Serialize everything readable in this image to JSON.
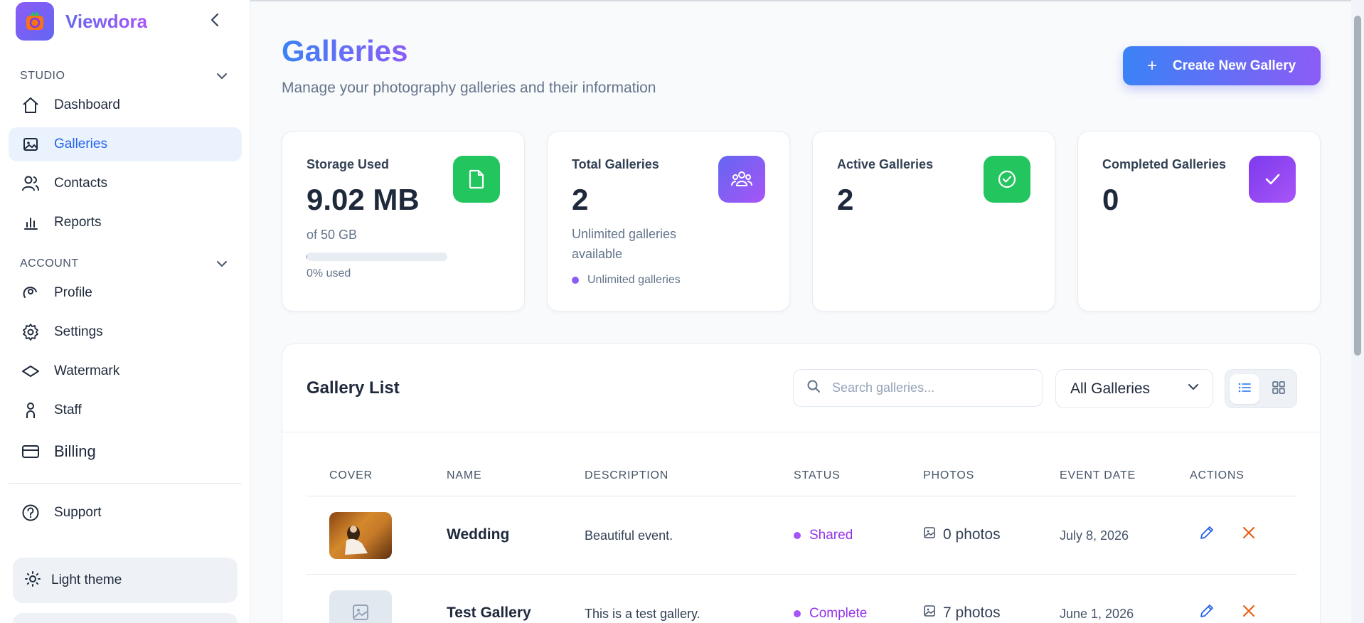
{
  "brand": {
    "name": "Viewdora"
  },
  "sidebar": {
    "sections": [
      {
        "label": "STUDIO"
      },
      {
        "label": "ACCOUNT"
      }
    ],
    "items": [
      {
        "label": "Dashboard",
        "icon": "home-icon"
      },
      {
        "label": "Galleries",
        "icon": "image-icon",
        "active": true
      },
      {
        "label": "Contacts",
        "icon": "users-icon"
      },
      {
        "label": "Reports",
        "icon": "bar-chart-icon"
      },
      {
        "label": "Profile",
        "icon": "profile-icon"
      },
      {
        "label": "Settings",
        "icon": "gear-icon"
      },
      {
        "label": "Watermark",
        "icon": "watermark-icon"
      },
      {
        "label": "Staff",
        "icon": "staff-icon"
      },
      {
        "label": "Billing",
        "icon": "credit-card-icon"
      },
      {
        "label": "Support",
        "icon": "help-circle-icon"
      }
    ],
    "theme_label": "Light theme"
  },
  "header": {
    "title": "Galleries",
    "subtitle": "Manage your photography galleries and their information",
    "create_label": "Create New Gallery"
  },
  "stats": {
    "storage": {
      "title": "Storage Used",
      "value": "9.02 MB",
      "sub": "of 50 GB",
      "progress_label": "0% used",
      "progress_fraction": 0.002,
      "color": "#22c55e"
    },
    "total": {
      "title": "Total Galleries",
      "value": "2",
      "sub": "Unlimited galleries available",
      "note": "Unlimited galleries",
      "color": "#8b5cf6"
    },
    "active": {
      "title": "Active Galleries",
      "value": "2",
      "color": "#22c55e"
    },
    "completed": {
      "title": "Completed Galleries",
      "value": "0",
      "color": "#8b5cf6"
    }
  },
  "gallery_list": {
    "title": "Gallery List",
    "search_placeholder": "Search galleries...",
    "filter_value": "All Galleries",
    "columns": [
      "COVER",
      "NAME",
      "DESCRIPTION",
      "STATUS",
      "PHOTOS",
      "EVENT DATE",
      "ACTIONS"
    ],
    "rows": [
      {
        "name": "Wedding",
        "description": "Beautiful event.",
        "status": "Shared",
        "photos": "0 photos",
        "event_date": "July 8, 2026",
        "cover": "photo"
      },
      {
        "name": "Test Gallery",
        "description": "This is a test gallery.",
        "status": "Complete",
        "photos": "7 photos",
        "event_date": "June 1, 2026",
        "cover": "placeholder"
      }
    ]
  },
  "colors": {
    "accent": "#3b82f6",
    "brand_purple": "#8b5cf6",
    "edit": "#2563eb",
    "delete": "#ea580c"
  }
}
